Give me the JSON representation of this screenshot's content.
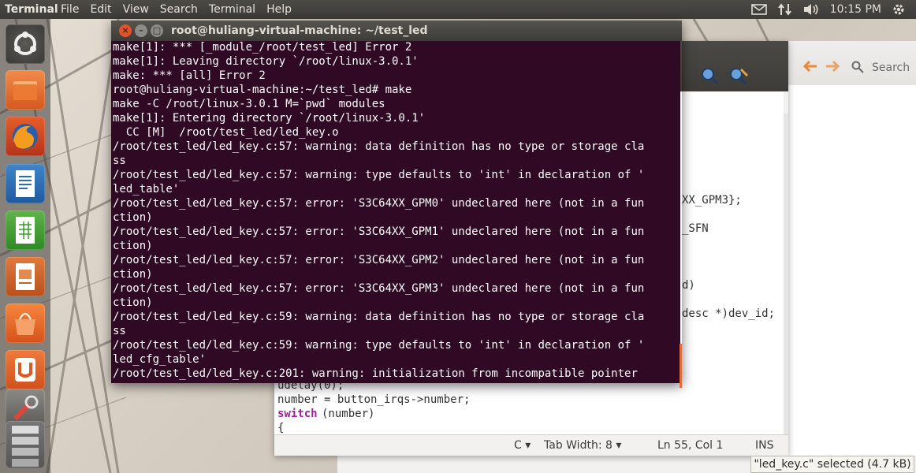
{
  "top_panel": {
    "app_title": "Terminal",
    "menu": [
      "File",
      "Edit",
      "View",
      "Search",
      "Terminal",
      "Help"
    ],
    "clock": "10:15 PM",
    "indicators": [
      "mail-icon",
      "network-arrows-icon",
      "volume-icon",
      "gear-icon"
    ]
  },
  "launcher": {
    "items": [
      "ubuntu-dash-icon",
      "files-icon",
      "firefox-icon",
      "writer-icon",
      "calc-icon",
      "impress-icon",
      "software-center-icon",
      "ubuntu-one-icon",
      "system-settings-icon",
      "workspaces-icon"
    ]
  },
  "terminal": {
    "title": "root@huliang-virtual-machine: ~/test_led",
    "lines": [
      "make[1]: *** [_module_/root/test_led] Error 2",
      "make[1]: Leaving directory `/root/linux-3.0.1'",
      "make: *** [all] Error 2",
      "root@huliang-virtual-machine:~/test_led# make",
      "make -C /root/linux-3.0.1 M=`pwd` modules",
      "make[1]: Entering directory `/root/linux-3.0.1'",
      "  CC [M]  /root/test_led/led_key.o",
      "/root/test_led/led_key.c:57: warning: data definition has no type or storage cla",
      "ss",
      "/root/test_led/led_key.c:57: warning: type defaults to 'int' in declaration of '",
      "led_table'",
      "/root/test_led/led_key.c:57: error: 'S3C64XX_GPM0' undeclared here (not in a fun",
      "ction)",
      "/root/test_led/led_key.c:57: error: 'S3C64XX_GPM1' undeclared here (not in a fun",
      "ction)",
      "/root/test_led/led_key.c:57: error: 'S3C64XX_GPM2' undeclared here (not in a fun",
      "ction)",
      "/root/test_led/led_key.c:57: error: 'S3C64XX_GPM3' undeclared here (not in a fun",
      "ction)",
      "/root/test_led/led_key.c:59: warning: data definition has no type or storage cla",
      "ss",
      "/root/test_led/led_key.c:59: warning: type defaults to 'int' in declaration of '",
      "led_cfg_table'",
      "/root/test_led/led_key.c:201: warning: initialization from incompatible pointer"
    ],
    "colors": {
      "background": "#300a24",
      "text": "#ffffff",
      "titlebar": "#3d3c38"
    }
  },
  "editor": {
    "visible_code_right": [
      "XX_GPM3};",
      "_SFN",
      "d)",
      "desc *)dev_id;"
    ],
    "visible_code_bottom": [
      "udelay(0);",
      "number = button_irqs->number;",
      "switch",
      "(number)",
      "{"
    ],
    "status": {
      "language": "C",
      "tab_width": "Tab Width: 8",
      "position": "Ln 55, Col 1",
      "mode": "INS"
    }
  },
  "file_manager": {
    "search_label": "Search",
    "selection_tip": "\"led_key.c\" selected (4.7 kB)"
  }
}
